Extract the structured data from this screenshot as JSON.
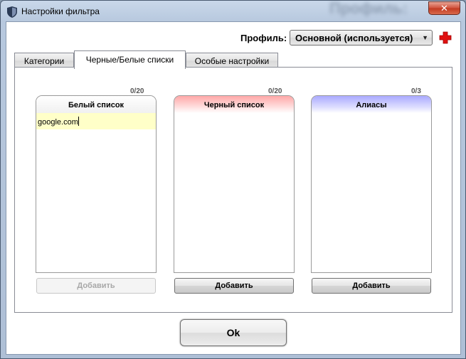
{
  "window": {
    "title": "Настройки фильтра",
    "blurred_title": "Профиль:",
    "close_label": "✕"
  },
  "profile": {
    "label": "Профиль:",
    "selected": "Основной (используется)"
  },
  "tabs": [
    {
      "label": "Категории",
      "active": false
    },
    {
      "label": "Черные/Белые списки",
      "active": true
    },
    {
      "label": "Особые настройки",
      "active": false
    }
  ],
  "lists": {
    "white": {
      "title": "Белый список",
      "counter": "0/20",
      "entries": [
        "google.com"
      ],
      "add_label": "Добавить",
      "add_enabled": false
    },
    "black": {
      "title": "Черный список",
      "counter": "0/20",
      "add_label": "Добавить",
      "add_enabled": true
    },
    "alias": {
      "title": "Алиасы",
      "counter": "0/3",
      "add_label": "Добавить",
      "add_enabled": true
    }
  },
  "ok_label": "Ok",
  "colors": {
    "black_header": "#ffa8a8",
    "alias_header": "#aaaaff",
    "entry_highlight": "#ffffc8",
    "add_profile_icon": "#e01010"
  }
}
